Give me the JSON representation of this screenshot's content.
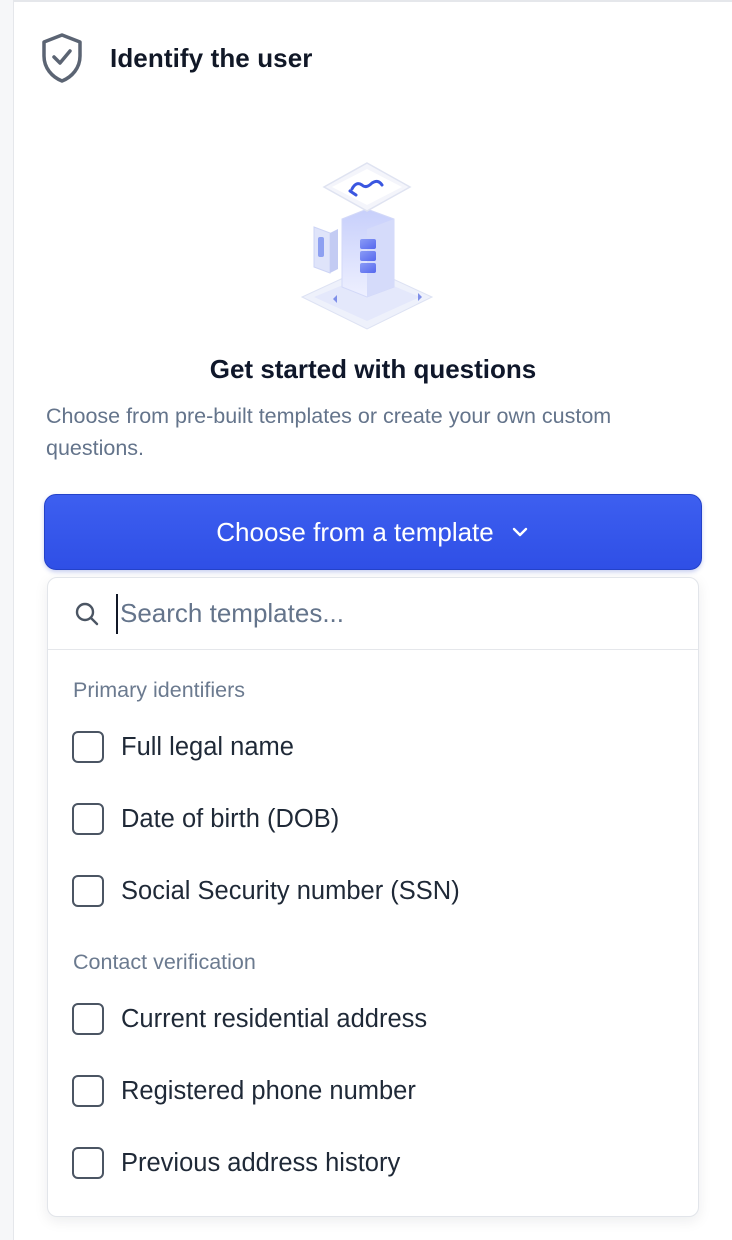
{
  "header": {
    "title": "Identify the user",
    "icon": "shield-check-icon"
  },
  "empty_state": {
    "illustration": "server-stack-illustration",
    "title": "Get started with questions",
    "description": "Choose from pre-built templates or create your own custom questions."
  },
  "template_button": {
    "label": "Choose from a template",
    "icon": "chevron-down-icon",
    "color": "#3352ea"
  },
  "dropdown": {
    "search": {
      "placeholder": "Search templates...",
      "value": ""
    },
    "groups": [
      {
        "label": "Primary identifiers",
        "options": [
          {
            "label": "Full legal name",
            "checked": false
          },
          {
            "label": "Date of birth (DOB)",
            "checked": false
          },
          {
            "label": "Social Security number (SSN)",
            "checked": false
          }
        ]
      },
      {
        "label": "Contact verification",
        "options": [
          {
            "label": "Current residential address",
            "checked": false
          },
          {
            "label": "Registered phone number",
            "checked": false
          },
          {
            "label": "Previous address history",
            "checked": false
          }
        ]
      }
    ]
  }
}
